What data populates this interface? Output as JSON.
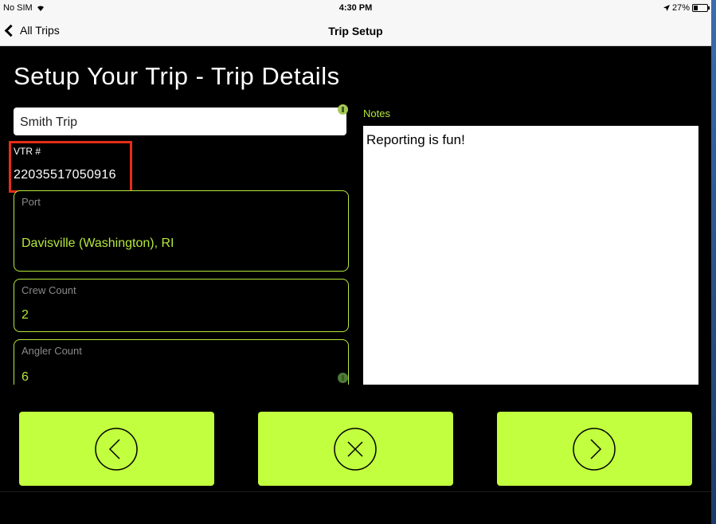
{
  "status_bar": {
    "carrier": "No SIM",
    "time": "4:30 PM",
    "battery": "27%",
    "battery_level": 0.27
  },
  "nav": {
    "back_label": "All Trips",
    "title": "Trip Setup"
  },
  "page": {
    "title": "Setup Your Trip - Trip Details"
  },
  "form": {
    "trip_name": "Smith Trip",
    "vtr": {
      "label": "VTR #",
      "value": "22035517050916"
    },
    "port": {
      "label": "Port",
      "value": "Davisville (Washington), RI"
    },
    "crew_count": {
      "label": "Crew Count",
      "value": "2"
    },
    "angler_count": {
      "label": "Angler Count",
      "value": "6"
    }
  },
  "notes": {
    "label": "Notes",
    "text": "Reporting is fun!"
  },
  "actions": {
    "prev": "previous-circle-icon",
    "cancel": "close-circle-icon",
    "next": "next-circle-icon"
  },
  "colors": {
    "accent": "#c1ff3f",
    "field_border": "#b6e83c",
    "highlight": "#e52d17",
    "background": "#000000"
  }
}
